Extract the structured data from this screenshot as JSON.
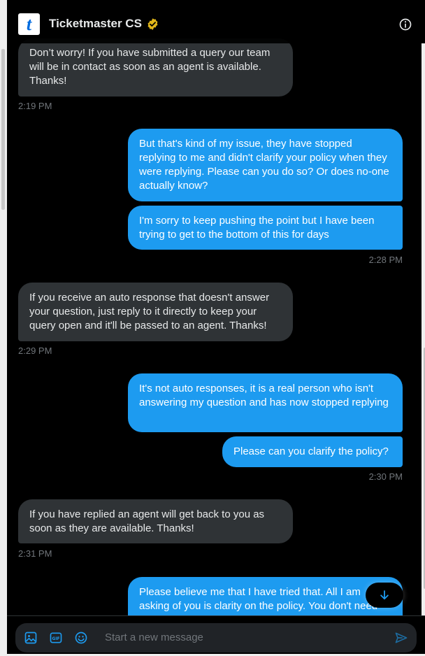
{
  "header": {
    "avatar_letter": "t",
    "title": "Ticketmaster CS"
  },
  "messages": [
    {
      "dir": "in",
      "text": "Don’t worry! If you have submitted a query our team will be in contact as soon as an agent is available. Thanks!"
    },
    {
      "dir": "time-in",
      "text": "2:19 PM"
    },
    {
      "dir": "out",
      "text": "But that's kind of my issue, they have stopped replying to me and didn't clarify your policy when they were replying. Please can you do so? Or does no-one actually know?"
    },
    {
      "dir": "out",
      "text": "I'm sorry to keep pushing the point but I have been trying to get to the bottom of this for days"
    },
    {
      "dir": "time-out",
      "text": "2:28 PM"
    },
    {
      "dir": "in",
      "text": "If you receive an auto response that doesn't answer your question, just reply to it directly to keep your query open and it'll be passed to an agent. Thanks!"
    },
    {
      "dir": "time-in",
      "text": "2:29 PM"
    },
    {
      "dir": "out",
      "text": "It's not auto responses, it is a real person who isn't answering my question and has now stopped replying"
    },
    {
      "dir": "out",
      "text": "Please can you clarify the policy?"
    },
    {
      "dir": "time-out",
      "text": "2:30 PM"
    },
    {
      "dir": "in",
      "text": "If you have replied an agent will get back to you as soon as they are available. Thanks!"
    },
    {
      "dir": "time-in",
      "text": "2:31 PM"
    },
    {
      "dir": "out",
      "text": "Please believe me that I have tried that. All I am asking of you is clarity on the policy. You don't need"
    }
  ],
  "composer": {
    "placeholder": "Start a new message",
    "icons": [
      "image-icon",
      "gif-icon",
      "emoji-icon",
      "send-icon"
    ]
  },
  "colors": {
    "accent": "#1d9bf0",
    "incoming_bubble": "#2f3336",
    "background": "#000000",
    "verified_badge": "#e2b719",
    "brand": "#026cdf"
  }
}
